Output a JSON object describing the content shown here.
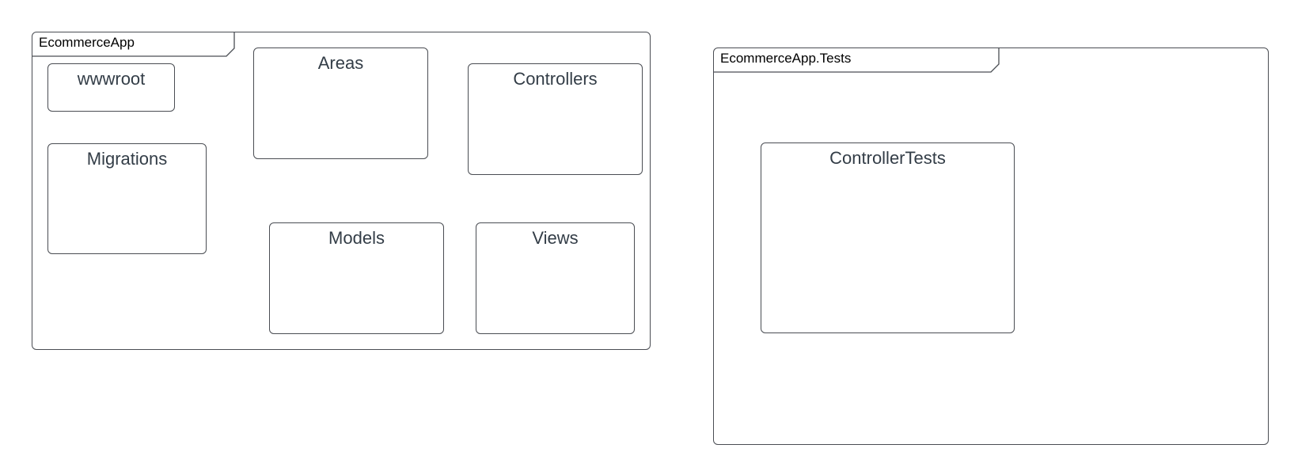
{
  "diagram": {
    "packages": [
      {
        "name": "EcommerceApp",
        "folders": [
          "wwwroot",
          "Areas",
          "Controllers",
          "Migrations",
          "Models",
          "Views"
        ]
      },
      {
        "name": "EcommerceApp.Tests",
        "folders": [
          "ControllerTests"
        ]
      }
    ]
  },
  "colors": {
    "border": "#4a4d53",
    "folder_text": "#333d47",
    "package_text": "#000000",
    "background": "#ffffff"
  }
}
